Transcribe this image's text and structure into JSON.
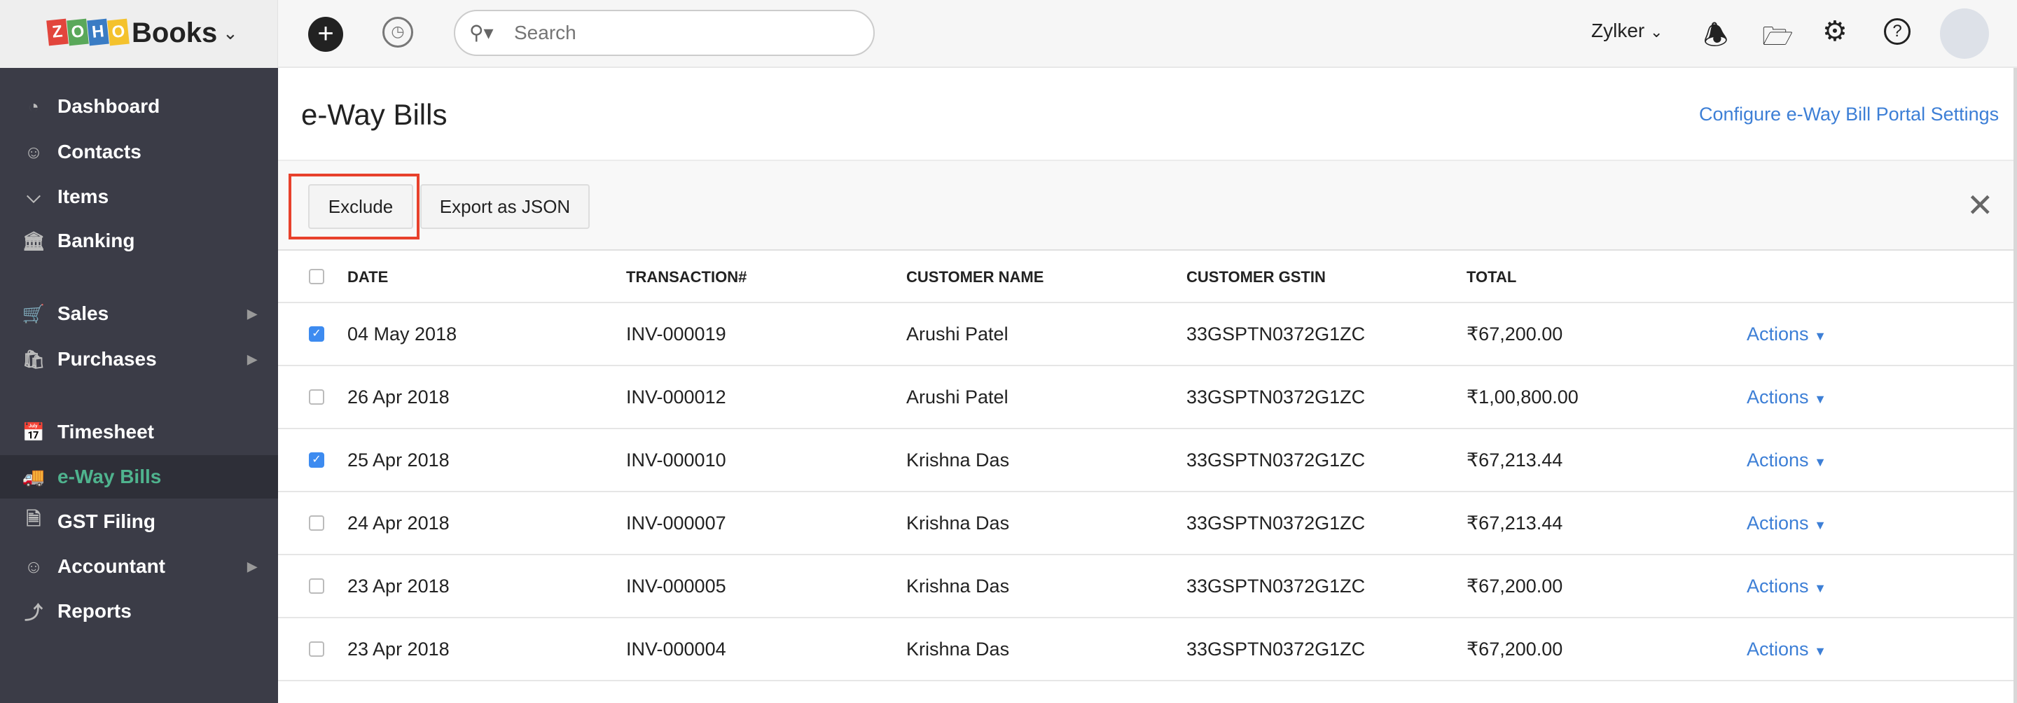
{
  "topbar": {
    "brand": "Books",
    "search_placeholder": "Search",
    "org": "Zylker"
  },
  "sidebar": {
    "items": [
      {
        "label": "Dashboard",
        "icon": "dashboard-icon"
      },
      {
        "label": "Contacts",
        "icon": "contacts-icon"
      },
      {
        "label": "Items",
        "icon": "items-icon"
      },
      {
        "label": "Banking",
        "icon": "banking-icon"
      },
      {
        "label": "Sales",
        "icon": "cart-icon",
        "submenu": true
      },
      {
        "label": "Purchases",
        "icon": "bag-icon",
        "submenu": true
      },
      {
        "label": "Timesheet",
        "icon": "timesheet-icon"
      },
      {
        "label": "e-Way Bills",
        "icon": "truck-icon",
        "active": true
      },
      {
        "label": "GST Filing",
        "icon": "gst-icon"
      },
      {
        "label": "Accountant",
        "icon": "accountant-icon",
        "submenu": true
      },
      {
        "label": "Reports",
        "icon": "reports-icon"
      }
    ]
  },
  "page": {
    "title": "e-Way Bills",
    "config_link": "Configure e-Way Bill Portal Settings"
  },
  "toolbar": {
    "exclude": "Exclude",
    "export": "Export as JSON"
  },
  "table": {
    "headers": [
      "DATE",
      "TRANSACTION#",
      "CUSTOMER NAME",
      "CUSTOMER GSTIN",
      "TOTAL"
    ],
    "rows": [
      {
        "checked": true,
        "date": "04 May 2018",
        "txn": "INV-000019",
        "customer": "Arushi Patel",
        "gstin": "33GSPTN0372G1ZC",
        "total": "₹67,200.00",
        "action": "Actions"
      },
      {
        "checked": false,
        "date": "26 Apr 2018",
        "txn": "INV-000012",
        "customer": "Arushi Patel",
        "gstin": "33GSPTN0372G1ZC",
        "total": "₹1,00,800.00",
        "action": "Actions"
      },
      {
        "checked": true,
        "date": "25 Apr 2018",
        "txn": "INV-000010",
        "customer": "Krishna Das",
        "gstin": "33GSPTN0372G1ZC",
        "total": "₹67,213.44",
        "action": "Actions"
      },
      {
        "checked": false,
        "date": "24 Apr 2018",
        "txn": "INV-000007",
        "customer": "Krishna Das",
        "gstin": "33GSPTN0372G1ZC",
        "total": "₹67,213.44",
        "action": "Actions"
      },
      {
        "checked": false,
        "date": "23 Apr 2018",
        "txn": "INV-000005",
        "customer": "Krishna Das",
        "gstin": "33GSPTN0372G1ZC",
        "total": "₹67,200.00",
        "action": "Actions"
      },
      {
        "checked": false,
        "date": "23 Apr 2018",
        "txn": "INV-000004",
        "customer": "Krishna Das",
        "gstin": "33GSPTN0372G1ZC",
        "total": "₹67,200.00",
        "action": "Actions"
      }
    ]
  },
  "colors": {
    "accent": "#3d7fd6",
    "active": "#4fb38e",
    "sidebar": "#3b3c47",
    "highlight": "#e8412c"
  }
}
